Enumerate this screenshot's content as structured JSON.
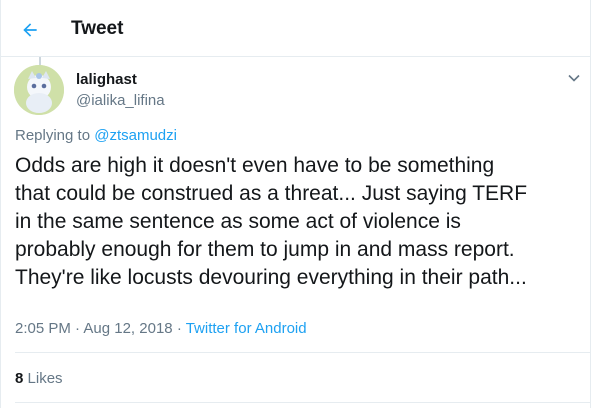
{
  "header": {
    "title": "Tweet",
    "back_icon": "arrow-left-icon",
    "accent_color": "#1da1f2"
  },
  "author": {
    "name": "lalighast",
    "handle": "@ialika_lifina",
    "avatar_icon": "avatar-image",
    "menu_icon": "chevron-down-icon"
  },
  "reply": {
    "prefix": "Replying to",
    "to": "@ztsamudzi"
  },
  "tweet": {
    "text": "Odds are high it doesn't even have to be something\nthat could be construed as a threat...  Just saying TERF\nin the same sentence as some act of violence is\nprobably enough for them to jump in and mass report.\nThey're like locusts devouring everything in their path..."
  },
  "meta": {
    "time": "2:05 PM",
    "sep1": "·",
    "date": "Aug 12, 2018",
    "sep2": "·",
    "source": "Twitter for Android"
  },
  "stats": {
    "likes_count": "8",
    "likes_label": "Likes"
  }
}
